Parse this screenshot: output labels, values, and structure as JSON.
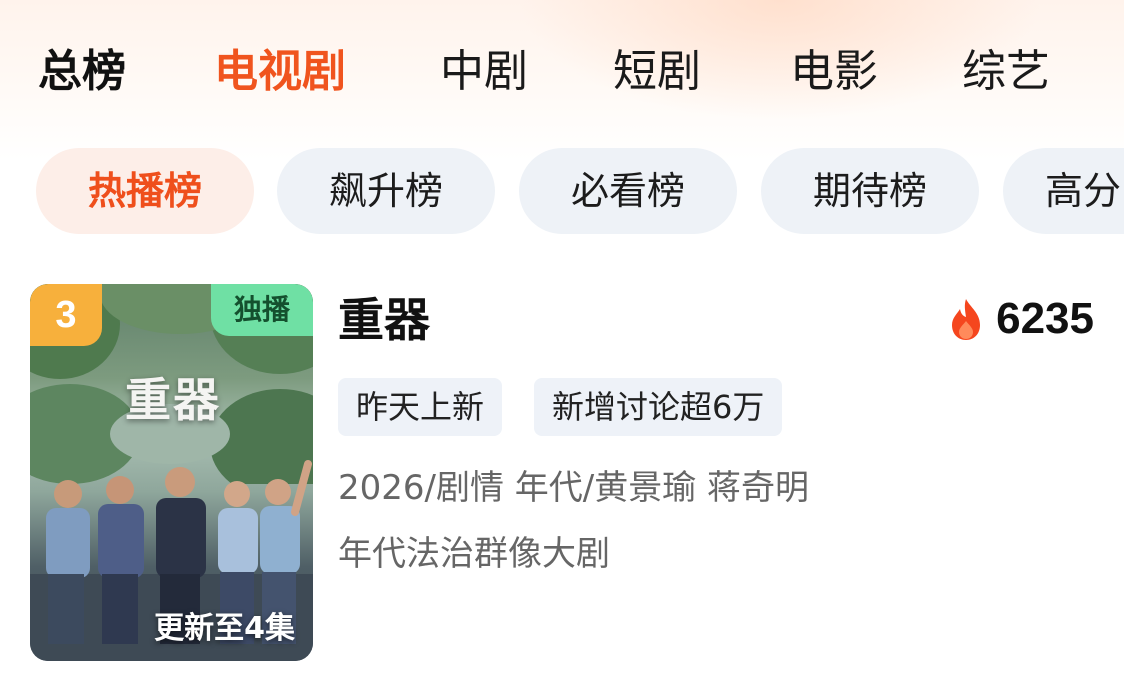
{
  "tabs": [
    {
      "label": "总榜"
    },
    {
      "label": "电视剧"
    },
    {
      "label": "中剧"
    },
    {
      "label": "短剧"
    },
    {
      "label": "电影"
    },
    {
      "label": "综艺"
    }
  ],
  "active_tab": "电视剧",
  "rank_tabs": [
    {
      "label": "热播榜"
    },
    {
      "label": "飙升榜"
    },
    {
      "label": "必看榜"
    },
    {
      "label": "期待榜"
    },
    {
      "label": "高分"
    }
  ],
  "active_rank_tab": "热播榜",
  "item": {
    "rank": "3",
    "badge": "独播",
    "poster_title": "重器",
    "episode": "更新至4集",
    "title": "重器",
    "heat": "6235",
    "tags": [
      "昨天上新",
      "新增讨论超6万"
    ],
    "meta_line": "2026/剧情 年代/黄景瑜 蒋奇明",
    "description": "年代法治群像大剧"
  },
  "colors": {
    "accent": "#f0541e",
    "pill_active_bg": "#fdeee8",
    "pill_bg": "#eef2f7",
    "rank_badge": "#f7b03c",
    "exclusive_badge": "#6fe0a4",
    "flame": "#f5461e"
  },
  "icons": {
    "heat": "flame-icon"
  }
}
